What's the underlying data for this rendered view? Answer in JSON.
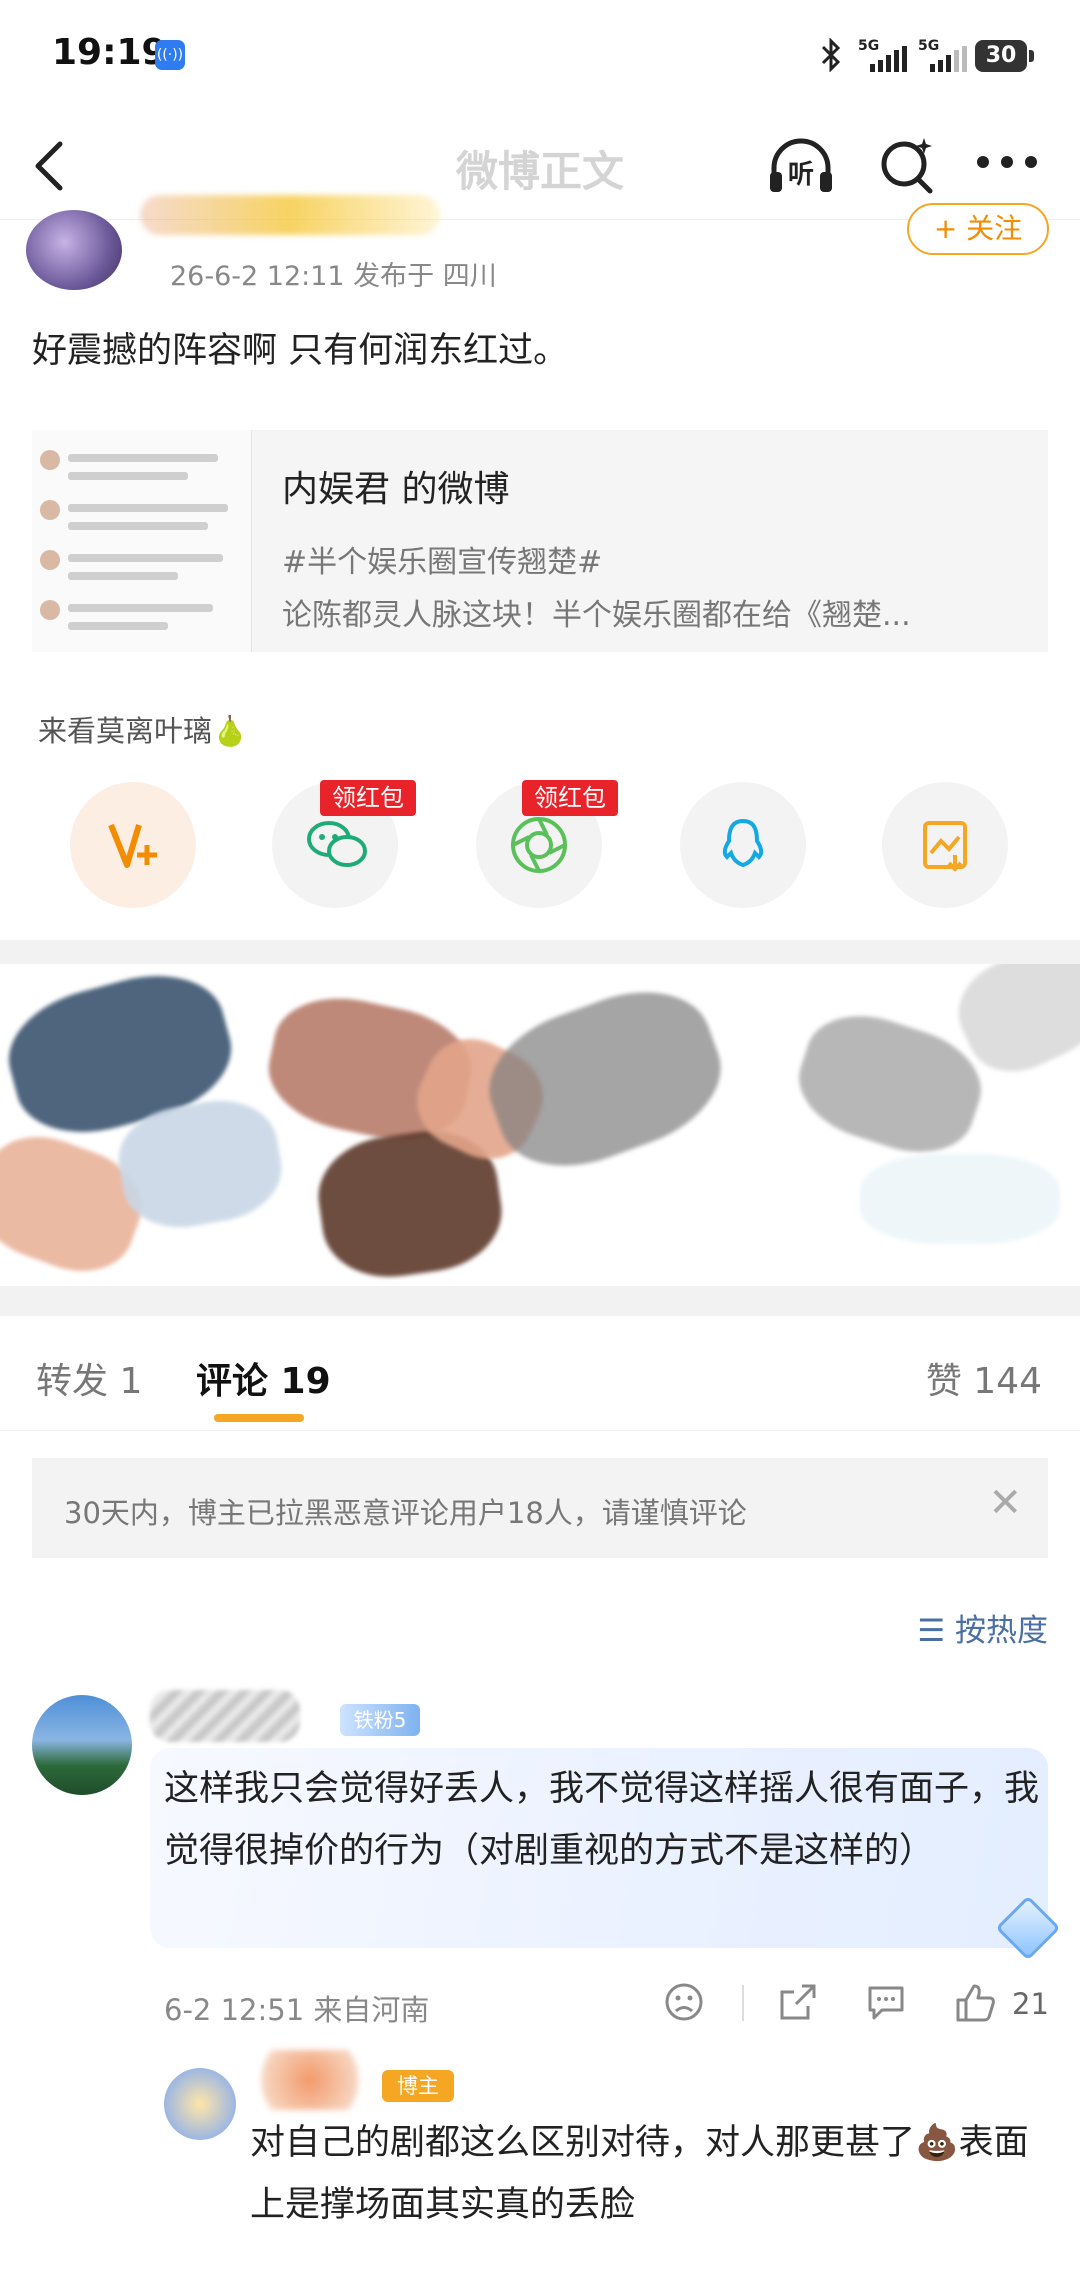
{
  "status_bar": {
    "time": "19:19",
    "network_badge": "((·))",
    "bluetooth_icon": "bluetooth-icon",
    "signal1_label": "5G",
    "signal2_label": "5G",
    "battery": "30"
  },
  "nav": {
    "title": "微博正文",
    "listen_label": "听"
  },
  "post": {
    "follow_label": "+ 关注",
    "meta": "26-6-2 12:11   发布于 四川",
    "text": "好震撼的阵容啊 只有何润东红过。",
    "card": {
      "title": "内娱君 的微博",
      "tag": "#半个娱乐圈宣传翘楚#",
      "desc": "论陈都灵人脉这块！半个娱乐圈都在给《翘楚..."
    },
    "extra_link": "来看莫离叶璃🍐"
  },
  "share": {
    "hongbao_label": "领红包",
    "items": [
      "vplus-icon",
      "wechat-icon",
      "moments-icon",
      "qq-icon",
      "save-image-icon"
    ]
  },
  "tabs": {
    "repost": "转发 1",
    "comments": "评论 19",
    "likes": "赞 144"
  },
  "notice": {
    "text": "30天内，博主已拉黑恶意评论用户18人，请谨慎评论",
    "close": "✕"
  },
  "sort": {
    "label": "按热度"
  },
  "comment": {
    "fan_badge": "铁粉5",
    "text": "这样我只会觉得好丢人，我不觉得这样摇人很有面子，我觉得很掉价的行为（对剧重视的方式不是这样的）",
    "meta": "6-2 12:51  来自河南",
    "likes": "21"
  },
  "reply": {
    "badge": "博主",
    "text": "对自己的剧都这么区别对待，对人那更甚了💩表面上是撑场面其实真的丢脸"
  },
  "colors": {
    "accent": "#f5a623",
    "link_blue": "#4a6fa5",
    "hongbao_red": "#e8232a"
  }
}
